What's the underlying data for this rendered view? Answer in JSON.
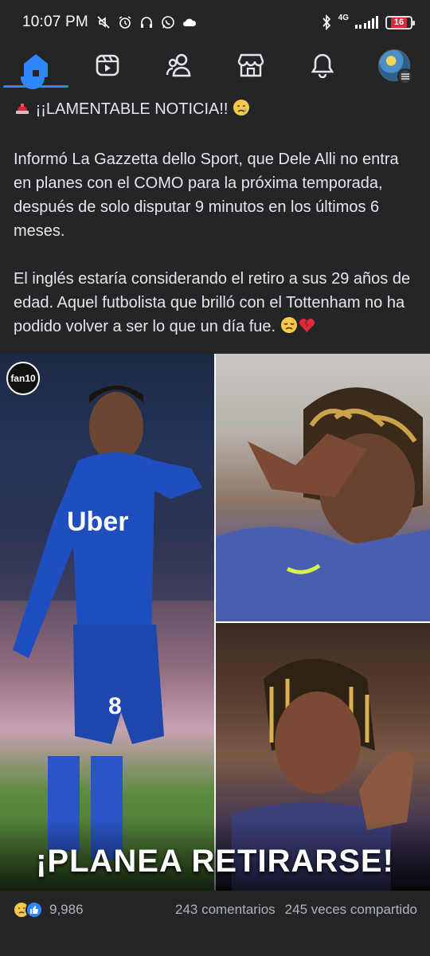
{
  "status_bar": {
    "time": "10:07 PM",
    "network": "4G",
    "battery": "16",
    "icons_left": [
      "mute-icon",
      "alarm-icon",
      "headphones-icon",
      "whatsapp-icon",
      "cloud-icon"
    ],
    "icons_right": [
      "bluetooth-icon",
      "signal-icon",
      "battery-icon"
    ]
  },
  "nav": {
    "items": [
      {
        "name": "home",
        "icon": "home-icon",
        "active": true
      },
      {
        "name": "video",
        "icon": "video-icon",
        "active": false
      },
      {
        "name": "friends",
        "icon": "friends-icon",
        "active": false
      },
      {
        "name": "marketplace",
        "icon": "marketplace-icon",
        "active": false
      },
      {
        "name": "notifications",
        "icon": "bell-icon",
        "active": false
      },
      {
        "name": "menu",
        "icon": "profile-avatar",
        "active": false
      }
    ],
    "accent": "#2d88ff"
  },
  "post": {
    "headline_text": "¡¡LAMENTABLE NOTICIA!!",
    "paragraph_1": "Informó La Gazzetta dello Sport, que Dele Alli no entra en planes con el COMO para la próxima temporada, después de solo disputar 9 minutos en los últimos 6 meses.",
    "paragraph_2": "El inglés estaría considerando el retiro a sus 29 años de edad. Aquel futbolista que brilló con el Tottenham no ha podido volver a ser lo que un día fue.",
    "image": {
      "logo_text": "fan10",
      "overlay_title": "¡PLANEA RETIRARSE!",
      "left_jersey_sponsor": "Uber",
      "left_jersey_number": "8"
    }
  },
  "reactions": {
    "count": "9,986",
    "comments": "243 comentarios",
    "shares": "245 veces compartido",
    "icons": [
      "sad-reaction-icon",
      "like-reaction-icon"
    ]
  }
}
